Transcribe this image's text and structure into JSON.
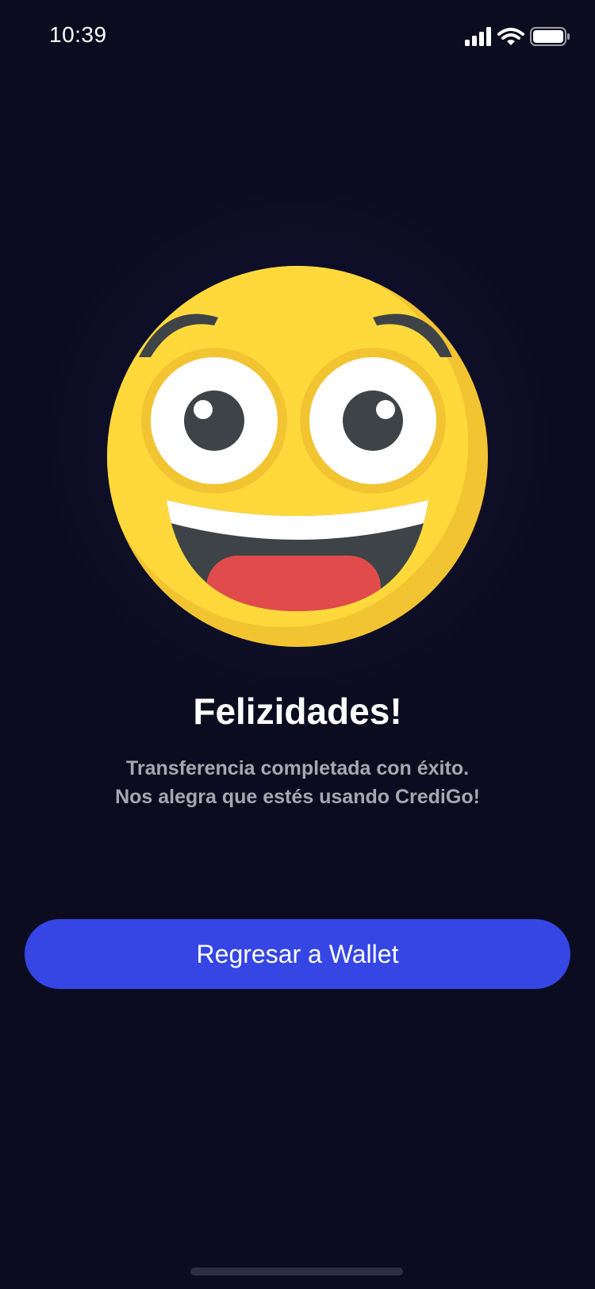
{
  "status_bar": {
    "time": "10:39",
    "icons": [
      "signal-icon",
      "wifi-icon",
      "battery-icon"
    ]
  },
  "illustration": {
    "name": "happy-emoji-icon",
    "colors": {
      "face": "#ffd93b",
      "face_shade": "#f3c432",
      "eye_white": "#ffffff",
      "pupil": "#3e4347",
      "tongue": "#e24b4b",
      "brow": "#3e4347"
    }
  },
  "message": {
    "title": "Felizidades!",
    "line1": "Transferencia completada con éxito.",
    "line2": "Nos alegra que estés usando CrediGo!"
  },
  "actions": {
    "back_label": "Regresar a Wallet"
  },
  "colors": {
    "background": "#0c0c20",
    "accent": "#3546e4",
    "subtitle_text": "#a7a7b1"
  }
}
